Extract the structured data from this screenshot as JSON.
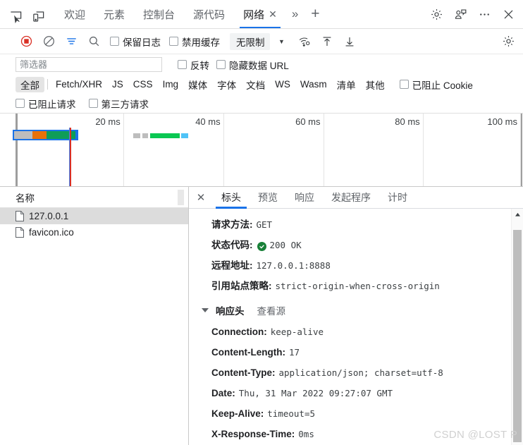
{
  "tabbar": {
    "icons": [
      {
        "name": "inspect-element-icon"
      },
      {
        "name": "device-toolbar-icon"
      }
    ],
    "tabs": [
      {
        "label": "欢迎",
        "active": false,
        "closable": false
      },
      {
        "label": "元素",
        "active": false,
        "closable": false
      },
      {
        "label": "控制台",
        "active": false,
        "closable": false
      },
      {
        "label": "源代码",
        "active": false,
        "closable": false
      },
      {
        "label": "网络",
        "active": true,
        "closable": true
      }
    ],
    "close_glyph": "✕",
    "more_tabs_glyph": "»",
    "new_tab_glyph": "+",
    "right_icons": [
      "settings-gear-icon",
      "feedback-icon",
      "more-options-icon",
      "close-devtools-icon"
    ]
  },
  "net_toolbar": {
    "record_label": "record-button",
    "clear_label": "clear-button",
    "filter_label": "filter-button",
    "search_label": "search-button",
    "preserve_log": "保留日志",
    "disable_cache": "禁用缓存",
    "throttle_value": "无限制",
    "caret": "▼",
    "icons": [
      "network-conditions-icon",
      "import-har-icon",
      "export-har-icon",
      "network-settings-icon"
    ]
  },
  "filter": {
    "placeholder": "筛选器",
    "value": "",
    "invert": "反转",
    "hide_data_urls": "隐藏数据 URL",
    "types": [
      "全部",
      "Fetch/XHR",
      "JS",
      "CSS",
      "Img",
      "媒体",
      "字体",
      "文档",
      "WS",
      "Wasm",
      "清单",
      "其他"
    ],
    "selected_type": "全部",
    "blocked_cookies": "已阻止 Cookie",
    "blocked_requests": "已阻止请求",
    "third_party": "第三方请求"
  },
  "overview": {
    "ticks": [
      {
        "label": "20 ms",
        "x_pct": 21.0
      },
      {
        "label": "40 ms",
        "x_pct": 40.9
      },
      {
        "label": "60 ms",
        "x_pct": 60.8
      },
      {
        "label": "80 ms",
        "x_pct": 80.6
      },
      {
        "label": "100 ms",
        "x_pct": 100.0
      }
    ],
    "bars": [
      {
        "name": "127.0.0.1",
        "selected": true,
        "left_pct": -1.0,
        "width_pct": 13.0,
        "segments": [
          {
            "color": "#bdbdbd",
            "left_pct": 0,
            "width_pct": 30
          },
          {
            "color": "#e8710a",
            "left_pct": 30,
            "width_pct": 22
          },
          {
            "color": "#0f9d58",
            "left_pct": 52,
            "width_pct": 44
          }
        ]
      },
      {
        "name": "favicon.ico",
        "selected": false,
        "left_pct": 23.0,
        "width_pct": 11.0,
        "segments": [
          {
            "color": "#bdbdbd",
            "left_pct": 0,
            "width_pct": 14
          },
          {
            "color": "#bdbdbd",
            "left_pct": 18,
            "width_pct": 10
          },
          {
            "color": "#0ac752",
            "left_pct": 32,
            "width_pct": 52
          },
          {
            "color": "#4fc3f7",
            "left_pct": 88,
            "width_pct": 12
          }
        ]
      }
    ],
    "event_lines": [
      {
        "type": "dom-content-loaded",
        "color": "#d93025",
        "x_pct": 10.5
      },
      {
        "type": "load",
        "color": "#4285f4",
        "x_pct": 10.2
      }
    ]
  },
  "request_list": {
    "column_header": "名称",
    "items": [
      {
        "label": "127.0.0.1",
        "selected": true,
        "icon": "document-icon"
      },
      {
        "label": "favicon.ico",
        "selected": false,
        "icon": "document-icon"
      }
    ]
  },
  "detail": {
    "close_glyph": "✕",
    "tabs": [
      {
        "label": "标头",
        "active": true
      },
      {
        "label": "预览",
        "active": false
      },
      {
        "label": "响应",
        "active": false
      },
      {
        "label": "发起程序",
        "active": false
      },
      {
        "label": "计时",
        "active": false
      }
    ],
    "general": [
      {
        "key": "请求方法:",
        "value": "GET",
        "status": false
      },
      {
        "key": "状态代码:",
        "value": "200 OK",
        "status": true
      },
      {
        "key": "远程地址:",
        "value": "127.0.0.1:8888",
        "status": false
      },
      {
        "key": "引用站点策略:",
        "value": "strict-origin-when-cross-origin",
        "status": false
      }
    ],
    "response_headers_title": "响应头",
    "view_source": "查看源",
    "response_headers": [
      {
        "key": "Connection:",
        "value": "keep-alive"
      },
      {
        "key": "Content-Length:",
        "value": "17"
      },
      {
        "key": "Content-Type:",
        "value": "application/json; charset=utf-8"
      },
      {
        "key": "Date:",
        "value": "Thu, 31 Mar 2022 09:27:07 GMT"
      },
      {
        "key": "Keep-Alive:",
        "value": "timeout=5"
      },
      {
        "key": "X-Response-Time:",
        "value": "0ms"
      }
    ]
  },
  "watermark": "CSDN @LOST P",
  "colors": {
    "accent": "#1a73e8",
    "record_red": "#d93025",
    "status_green": "#188038",
    "selection_gray": "#dcdcdc"
  }
}
